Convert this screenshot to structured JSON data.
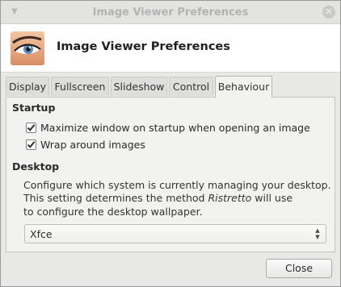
{
  "window": {
    "title": "Image Viewer Preferences"
  },
  "header": {
    "title": "Image Viewer Preferences",
    "icon": "eye-app-icon"
  },
  "tabs": [
    {
      "label": "Display",
      "active": false
    },
    {
      "label": "Fullscreen",
      "active": false
    },
    {
      "label": "Slideshow",
      "active": false
    },
    {
      "label": "Control",
      "active": false
    },
    {
      "label": "Behaviour",
      "active": true
    }
  ],
  "startup": {
    "title": "Startup",
    "options": [
      {
        "label": "Maximize window on startup when opening an image",
        "checked": true
      },
      {
        "label": "Wrap around images",
        "checked": true
      }
    ]
  },
  "desktop": {
    "title": "Desktop",
    "desc_line1": "Configure which system is currently managing your desktop.",
    "desc_line2_pre": "This setting determines the method ",
    "desc_line2_em": "Ristretto",
    "desc_line2_post": " will use",
    "desc_line3": "to configure the desktop wallpaper.",
    "selected": "Xfce"
  },
  "footer": {
    "close_label": "Close"
  }
}
